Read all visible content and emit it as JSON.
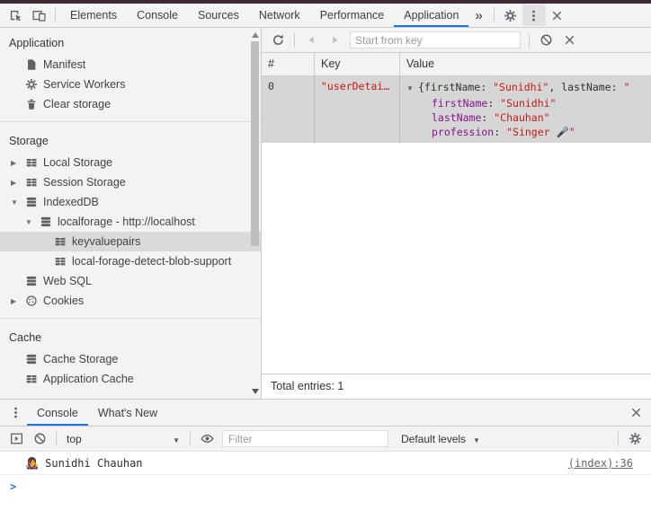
{
  "colors": {
    "accent_blue": "#1a73e8",
    "string_red": "#c41a16",
    "property_purple": "#881391",
    "selected_gray": "#d6d6d6"
  },
  "main_tabs": {
    "items": [
      "Elements",
      "Console",
      "Sources",
      "Network",
      "Performance",
      "Application"
    ],
    "selected": "Application"
  },
  "sidebar": {
    "items": [
      {
        "label": "Application",
        "type": "header"
      },
      {
        "label": "Manifest",
        "icon": "document-icon"
      },
      {
        "label": "Service Workers",
        "icon": "gear-icon"
      },
      {
        "label": "Clear storage",
        "icon": "trash-icon"
      },
      {
        "label": "Storage",
        "type": "header"
      },
      {
        "label": "Local Storage",
        "icon": "table-icon",
        "state": "collapsed"
      },
      {
        "label": "Session Storage",
        "icon": "table-icon",
        "state": "collapsed"
      },
      {
        "label": "IndexedDB",
        "icon": "database-icon",
        "state": "expanded"
      },
      {
        "label": "localforage - http://localhost",
        "icon": "database-icon",
        "state": "expanded"
      },
      {
        "label": "keyvaluepairs",
        "icon": "table-icon",
        "selected": true
      },
      {
        "label": "local-forage-detect-blob-support",
        "icon": "table-icon"
      },
      {
        "label": "Web SQL",
        "icon": "database-icon"
      },
      {
        "label": "Cookies",
        "icon": "cookie-icon",
        "state": "collapsed"
      },
      {
        "label": "Cache",
        "type": "header"
      },
      {
        "label": "Cache Storage",
        "icon": "database-icon"
      },
      {
        "label": "Application Cache",
        "icon": "table-icon"
      }
    ]
  },
  "idb_panel": {
    "search_placeholder": "Start from key",
    "columns": [
      "#",
      "Key",
      "Value"
    ],
    "row": {
      "index": "0",
      "key": "\"userDetai…",
      "preview_segments": [
        {
          "text": "{firstName: ",
          "color": "plain"
        },
        {
          "text": "\"Sunidhi\"",
          "color": "string"
        },
        {
          "text": ", lastName: ",
          "color": "plain"
        },
        {
          "text": "\"",
          "color": "string"
        }
      ],
      "properties": [
        {
          "name": "firstName",
          "value": "\"Sunidhi\""
        },
        {
          "name": "lastName",
          "value": "\"Chauhan\""
        },
        {
          "name": "profession",
          "value": "\"Singer 🎤\""
        }
      ]
    },
    "status": "Total entries: 1"
  },
  "drawer": {
    "tabs": [
      "Console",
      "What's New"
    ],
    "selected": "Console",
    "toolbar": {
      "context": "top",
      "filter_placeholder": "Filter",
      "levels": "Default levels"
    },
    "log": {
      "message": "👩‍🎤 Sunidhi Chauhan",
      "source": "(index):36"
    }
  }
}
